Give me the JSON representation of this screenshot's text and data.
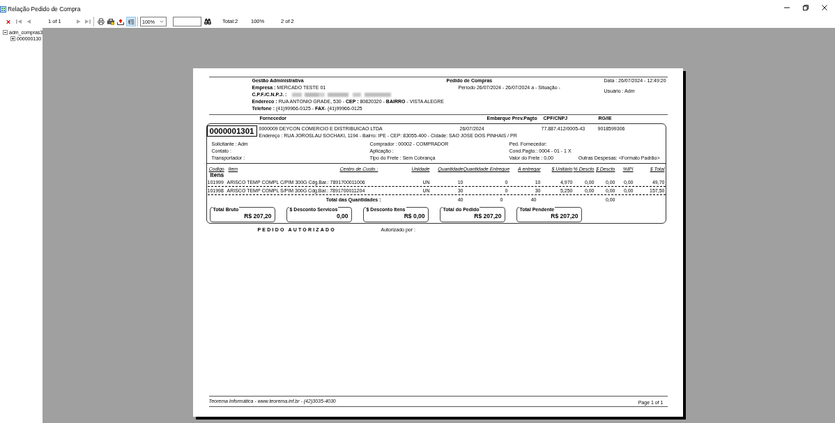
{
  "window": {
    "title": "Relação Pedido de Compra"
  },
  "toolbar": {
    "first_page": {
      "disabled": true
    },
    "previous_page": {
      "disabled": true
    },
    "page_indicator": "1 of 1",
    "next_page": {
      "disabled": true
    },
    "last_page": {
      "disabled": true
    },
    "tree_toggle": {
      "selected": true
    },
    "zoom": "100%",
    "total": "Total:2",
    "zoom_readout": "100%",
    "page_count": "2 of 2"
  },
  "tree": [
    {
      "label": "adm_compras3",
      "expanded": true,
      "children": [
        {
          "label": "000000130",
          "expanded": false
        }
      ]
    }
  ],
  "report": {
    "company": {
      "name": "Gestão Administrativa",
      "empresa": "**Empresa :** MERCADO TESTE 01",
      "cnpj_label": "C.P.F./C.N.P.J. :",
      "address": "**Endereco :** RUA ANTONIO GRADE, 530 - **CEP :** 80820320 - **BAIRRO** - VISTA ALEGRE",
      "phone": "**Telefone :** (41)99966-0125 - **FAX**- (41)99966-0125"
    },
    "title": "Pedido de Compras",
    "period": "Período 26/07/2024 - 26/07/2024 a - Situação -",
    "date": "Data : 26/07/2024 - 12:49:20",
    "user": "Usuário : Adm",
    "columns": [
      "Fornecedor",
      "Embarque Prev.Pagto",
      "CPF/CNPJ",
      "RG/IE"
    ],
    "order": {
      "number": "0000001301",
      "supplier": "0000009 DEYCON COMERCIO E DISTRIBUICAO LTDA",
      "date": "26/07/2024",
      "cnpj": "77.887.412/0005-43",
      "rg_ie": "9018599306",
      "address": "Endereço : RUA JOROSLAU SOCHAKI, 1194 - Bairro: IPE - CEP: 83055-400 - Cidade: SAO JOSE DOS PINHAIS / PR",
      "details": [
        [
          "Solicitante : Adm",
          "Contato :",
          "Transportador :"
        ],
        [
          "Comprador : 00002 - COMPRADOR",
          "Aplicação :",
          "Tipo do Frete : Sem Cobrança"
        ],
        [
          "Ped. Fornecedor:",
          "Cond.Pagto.: 0004 - 01 - 1 X",
          "Valor do Frete : 0,00"
        ]
      ],
      "other_expenses": "Outras Despesas: <Formato Padrão>"
    },
    "items": {
      "columns": [
        "Codigo",
        "Item",
        "Centro de Custo :",
        "Unidade",
        "Quantidade",
        "Quantidade Entregue",
        "A entregar",
        "$ Unitário",
        "% Descto",
        "$ Descto",
        "%IPI",
        "$ Total"
      ],
      "section_title": "Itens",
      "rows": [
        {
          "code": "101999",
          "item": "ARISCO TEMP COMPL C/PIM 300G Cdg.Bar.: 7891700011006",
          "unit": "UN",
          "quantity": "10",
          "delivered": "0",
          "to_deliver": "10",
          "unit_price": "4,970",
          "discount_pct": "0,00",
          "discount_value": "0,00",
          "ipi_pct": "0,00",
          "total": "49,70"
        },
        {
          "code": "101998",
          "item": "ARISCO TEMP COMPL S/PIM 300G Cdg.Bar.: 7891700011204",
          "unit": "UN",
          "quantity": "30",
          "delivered": "0",
          "to_deliver": "30",
          "unit_price": "5,250",
          "discount_pct": "0,00",
          "discount_value": "0,00",
          "ipi_pct": "0,00",
          "total": "157,50"
        }
      ],
      "totals": {
        "label": "Total das Quantidades :",
        "quantity": "40",
        "delivered": "0",
        "to_deliver": "40",
        "discount_value": "0,00"
      }
    },
    "summary": [
      {
        "label": "Total Bruto",
        "value": "R$ 207,20"
      },
      {
        "label": "$ Desconto Servicos",
        "value": "0,00"
      },
      {
        "label": "$ Desconto Itens",
        "value": "R$ 0,00"
      },
      {
        "label": "Total do Pedido",
        "value": "R$ 207,20"
      },
      {
        "label": "Total Pendente",
        "value": "R$ 207,20"
      }
    ],
    "authorization": "PEDIDO AUTORIZADO",
    "authorized_by": "Autorizado por :",
    "footer": {
      "company": "Teorema Informática - www.teorema.inf.br - (42)3035-4030",
      "page": "Page 1 of 1"
    }
  }
}
